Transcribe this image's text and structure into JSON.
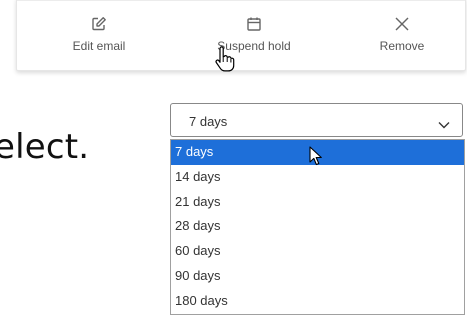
{
  "actions": [
    {
      "label": "Edit email",
      "icon": "edit-icon"
    },
    {
      "label": "Suspend hold",
      "icon": "calendar-icon"
    },
    {
      "label": "Remove",
      "icon": "close-icon"
    }
  ],
  "page": {
    "fragment_text": "elect."
  },
  "select": {
    "value": "7 days",
    "options": [
      "7 days",
      "14 days",
      "21 days",
      "28 days",
      "60 days",
      "90 days",
      "180 days"
    ],
    "highlighted": "7 days"
  },
  "colors": {
    "highlight": "#1e6fd9",
    "icon": "#666666"
  }
}
